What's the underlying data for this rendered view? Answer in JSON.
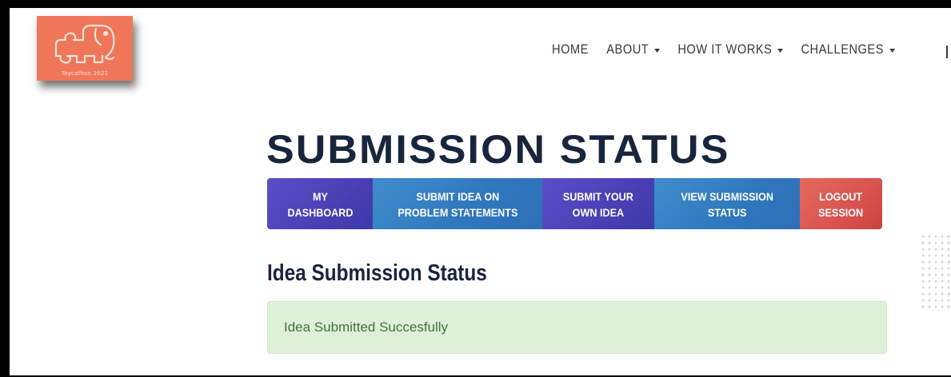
{
  "logo": {
    "text": "Toycathon 2021",
    "icon": "elephant-puzzle-icon",
    "color": "#f0765a"
  },
  "nav": {
    "items": [
      {
        "label": "HOME",
        "dropdown": false
      },
      {
        "label": "ABOUT",
        "dropdown": true
      },
      {
        "label": "HOW IT WORKS",
        "dropdown": true
      },
      {
        "label": "CHALLENGES",
        "dropdown": true
      }
    ]
  },
  "page": {
    "title": "SUBMISSION STATUS"
  },
  "buttons": {
    "dashboard": "MY\nDASHBOARD",
    "submit_problem": "SUBMIT IDEA ON\nPROBLEM STATEMENTS",
    "submit_own": "SUBMIT YOUR\nOWN IDEA",
    "view_status": "VIEW SUBMISSION\nSTATUS",
    "logout": "LOGOUT\nSESSION"
  },
  "section": {
    "heading": "Idea Submission Status"
  },
  "alert": {
    "message": "Idea Submitted Succesfully",
    "type": "success"
  },
  "colors": {
    "title": "#17253d",
    "purple_button": "#4a3fb5",
    "blue_button": "#2f77bd",
    "red_button": "#d9534f",
    "alert_bg": "#dff0d8",
    "alert_text": "#3c763d"
  }
}
